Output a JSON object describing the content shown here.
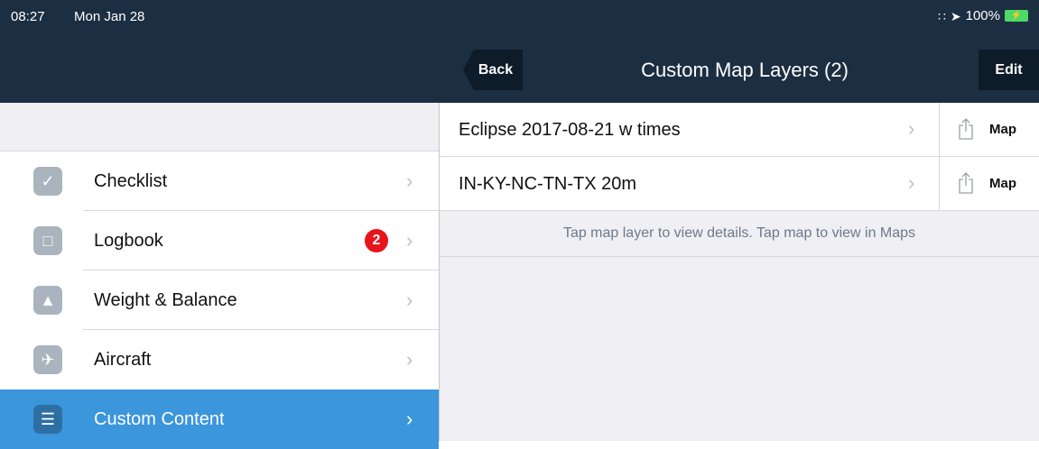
{
  "status_bar": {
    "time": "08:27",
    "date": "Mon Jan 28",
    "wifi_icon": "∷",
    "location_icon": "➤",
    "battery_text": "100%",
    "battery_glyph": "⚡"
  },
  "nav": {
    "back_label": "Back",
    "title": "Custom Map Layers (2)",
    "edit_label": "Edit"
  },
  "sidebar": {
    "items": [
      {
        "label": "Checklist",
        "icon": "checkmark-icon",
        "glyph": "✓",
        "chevron": "›"
      },
      {
        "label": "Logbook",
        "icon": "book-icon",
        "glyph": "□",
        "chevron": "›",
        "badge": "2"
      },
      {
        "label": "Weight & Balance",
        "icon": "weight-icon",
        "glyph": "▲",
        "chevron": "›"
      },
      {
        "label": "Aircraft",
        "icon": "airplane-icon",
        "glyph": "✈",
        "chevron": "›"
      },
      {
        "label": "Custom Content",
        "icon": "document-icon",
        "glyph": "☰",
        "chevron": "›",
        "active": true
      }
    ]
  },
  "layers": {
    "rows": [
      {
        "name": "Eclipse 2017-08-21 w times",
        "chevron": "›",
        "action_label": "Map"
      },
      {
        "name": "IN-KY-NC-TN-TX 20m",
        "chevron": "›",
        "action_label": "Map"
      }
    ],
    "hint": "Tap map layer to view details. Tap map to view in Maps"
  },
  "colors": {
    "header_bg": "#1c2e42",
    "button_bg": "#0e1b29",
    "active_bg": "#3b96dc",
    "badge_bg": "#e8141b"
  }
}
